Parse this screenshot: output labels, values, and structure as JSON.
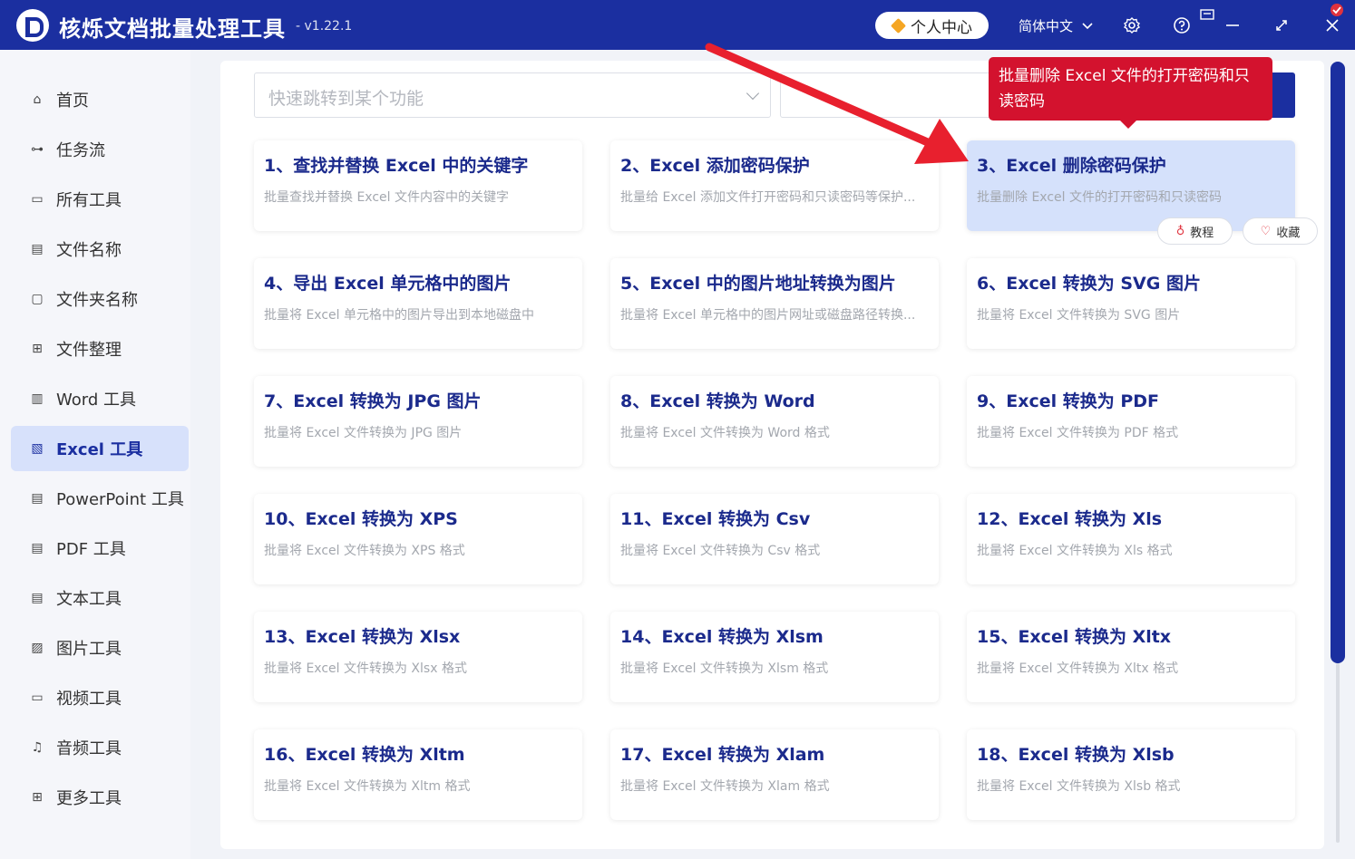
{
  "app": {
    "title": "核烁文档批量处理工具",
    "version": "- v1.22.1",
    "user_center": "个人中心",
    "language": "简体中文"
  },
  "sidebar": {
    "items": [
      {
        "label": "首页",
        "icon": "home-icon"
      },
      {
        "label": "任务流",
        "icon": "workflow-icon"
      },
      {
        "label": "所有工具",
        "icon": "monitor-icon"
      },
      {
        "label": "文件名称",
        "icon": "file-name-icon"
      },
      {
        "label": "文件夹名称",
        "icon": "folder-icon"
      },
      {
        "label": "文件整理",
        "icon": "organize-icon"
      },
      {
        "label": "Word 工具",
        "icon": "word-icon"
      },
      {
        "label": "Excel 工具",
        "icon": "excel-icon",
        "active": true
      },
      {
        "label": "PowerPoint 工具",
        "icon": "ppt-icon"
      },
      {
        "label": "PDF 工具",
        "icon": "pdf-icon"
      },
      {
        "label": "文本工具",
        "icon": "text-icon"
      },
      {
        "label": "图片工具",
        "icon": "image-icon"
      },
      {
        "label": "视频工具",
        "icon": "video-icon"
      },
      {
        "label": "音频工具",
        "icon": "audio-icon"
      },
      {
        "label": "更多工具",
        "icon": "grid-icon"
      }
    ]
  },
  "search": {
    "placeholder": "快速跳转到某个功能"
  },
  "tooltip": {
    "text": "批量删除 Excel 文件的打开密码和只读密码"
  },
  "card_actions": {
    "tutorial": "教程",
    "favorite": "收藏"
  },
  "cards": [
    {
      "title": "1、查找并替换 Excel 中的关键字",
      "desc": "批量查找并替换 Excel 文件内容中的关键字"
    },
    {
      "title": "2、Excel 添加密码保护",
      "desc": "批量给 Excel 添加文件打开密码和只读密码等保护..."
    },
    {
      "title": "3、Excel 删除密码保护",
      "desc": "批量删除 Excel 文件的打开密码和只读密码",
      "highlighted": true
    },
    {
      "title": "4、导出 Excel 单元格中的图片",
      "desc": "批量将 Excel 单元格中的图片导出到本地磁盘中"
    },
    {
      "title": "5、Excel 中的图片地址转换为图片",
      "desc": "批量将 Excel 单元格中的图片网址或磁盘路径转换..."
    },
    {
      "title": "6、Excel 转换为 SVG 图片",
      "desc": "批量将 Excel 文件转换为 SVG 图片"
    },
    {
      "title": "7、Excel 转换为 JPG 图片",
      "desc": "批量将 Excel 文件转换为 JPG 图片"
    },
    {
      "title": "8、Excel 转换为 Word",
      "desc": "批量将 Excel 文件转换为 Word 格式"
    },
    {
      "title": "9、Excel 转换为 PDF",
      "desc": "批量将 Excel 文件转换为 PDF 格式"
    },
    {
      "title": "10、Excel 转换为 XPS",
      "desc": "批量将 Excel 文件转换为 XPS 格式"
    },
    {
      "title": "11、Excel 转换为 Csv",
      "desc": "批量将 Excel 文件转换为 Csv 格式"
    },
    {
      "title": "12、Excel 转换为 Xls",
      "desc": "批量将 Excel 文件转换为 Xls 格式"
    },
    {
      "title": "13、Excel 转换为 Xlsx",
      "desc": "批量将 Excel 文件转换为 Xlsx 格式"
    },
    {
      "title": "14、Excel 转换为 Xlsm",
      "desc": "批量将 Excel 文件转换为 Xlsm 格式"
    },
    {
      "title": "15、Excel 转换为 Xltx",
      "desc": "批量将 Excel 文件转换为 Xltx 格式"
    },
    {
      "title": "16、Excel 转换为 Xltm",
      "desc": "批量将 Excel 文件转换为 Xltm 格式"
    },
    {
      "title": "17、Excel 转换为 Xlam",
      "desc": "批量将 Excel 文件转换为 Xlam 格式"
    },
    {
      "title": "18、Excel 转换为 Xlsb",
      "desc": "批量将 Excel 文件转换为 Xlsb 格式"
    }
  ],
  "colors": {
    "brand": "#1b2fa0",
    "highlight_card": "#d5e1fb",
    "tooltip": "#d3122e",
    "annotation_arrow": "#e8202e"
  }
}
